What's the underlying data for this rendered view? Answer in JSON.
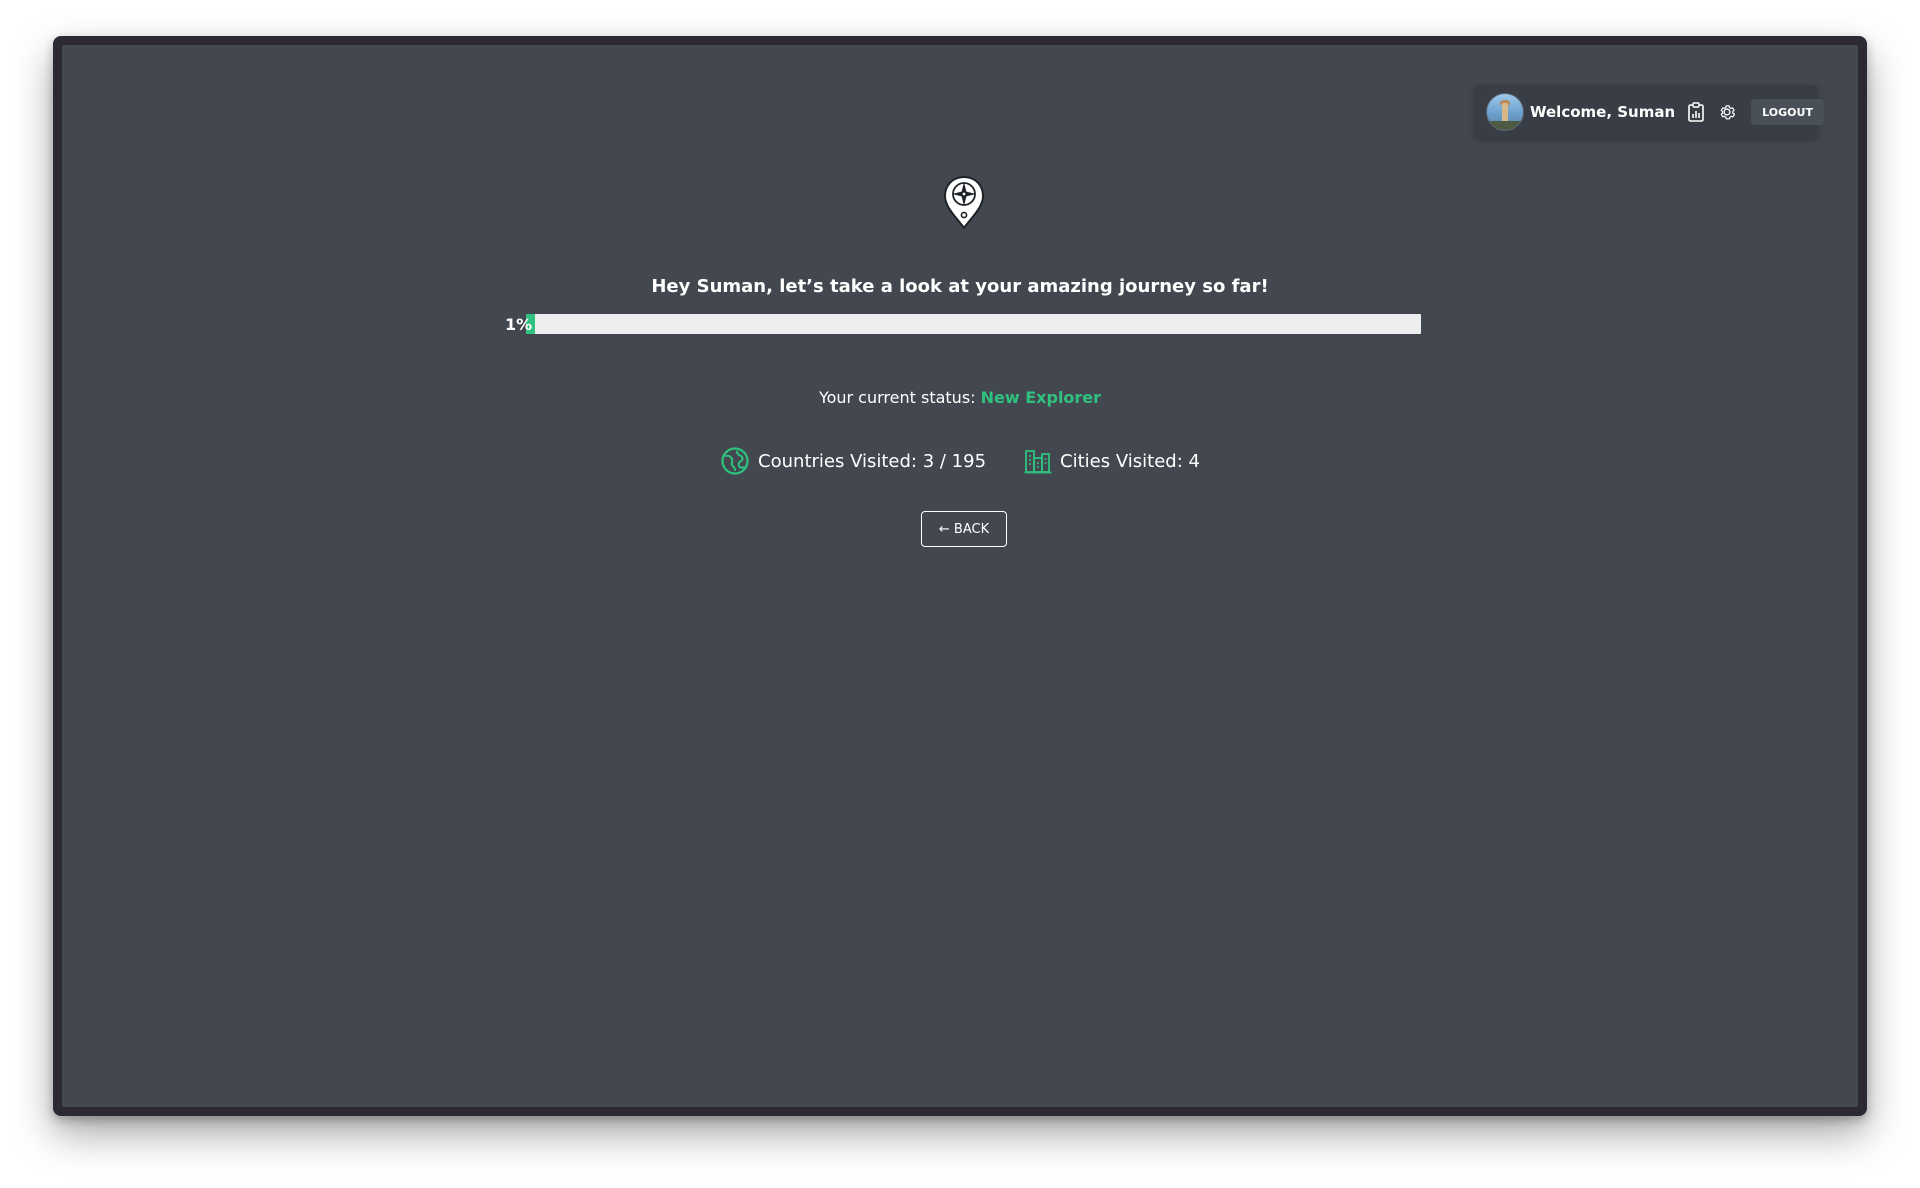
{
  "header": {
    "welcome_text": "Welcome, Suman",
    "stats_icon": "clipboard-chart-icon",
    "settings_icon": "gear-icon",
    "logout_label": "LOGOUT"
  },
  "main": {
    "logo_icon": "compass-pin-icon",
    "greeting": "Hey Suman, let’s take a look at your amazing journey so far!",
    "progress": {
      "label": "1%",
      "percent": 1
    },
    "status_prefix": "Your current status:",
    "status_value": "New Explorer",
    "stats": {
      "countries_icon": "globe-icon",
      "countries_text": "Countries Visited: 3 / 195",
      "cities_icon": "city-buildings-icon",
      "cities_text": "Cities Visited: 4"
    },
    "back_label": "← BACK"
  },
  "colors": {
    "accent": "#2ec27e",
    "background": "#434850",
    "user_bar": "#393e46"
  }
}
